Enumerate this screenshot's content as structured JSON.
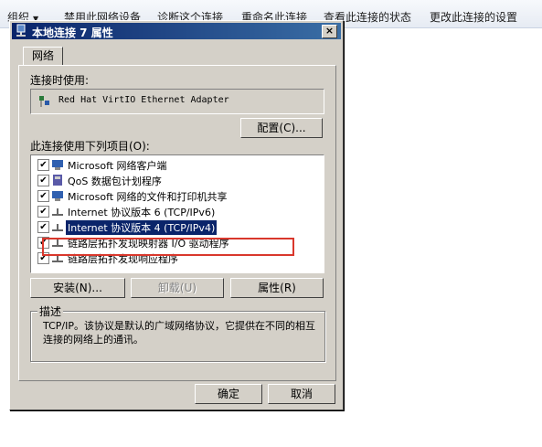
{
  "commandbar": {
    "items": [
      "组织",
      "禁用此网络设备",
      "诊断这个连接",
      "重命名此连接",
      "查看此连接的状态",
      "更改此连接的设置"
    ]
  },
  "dialog": {
    "title": "本地连接 7 属性",
    "close_label": "×",
    "tab_label": "网络",
    "connect_using_label": "连接时使用:",
    "adapter_name": "Red Hat VirtIO Ethernet Adapter",
    "configure_button": "配置(C)...",
    "items_label": "此连接使用下列项目(O):",
    "items": [
      {
        "label": "Microsoft 网络客户端",
        "checked": true,
        "icon": "client-icon"
      },
      {
        "label": "QoS 数据包计划程序",
        "checked": true,
        "icon": "qos-icon"
      },
      {
        "label": "Microsoft 网络的文件和打印机共享",
        "checked": true,
        "icon": "share-icon"
      },
      {
        "label": "Internet 协议版本 6 (TCP/IPv6)",
        "checked": true,
        "icon": "protocol-icon"
      },
      {
        "label": "Internet 协议版本 4 (TCP/IPv4)",
        "checked": true,
        "icon": "protocol-icon",
        "selected": true
      },
      {
        "label": "链路层拓扑发现映射器 I/O 驱动程序",
        "checked": true,
        "icon": "protocol-icon"
      },
      {
        "label": "链路层拓扑发现响应程序",
        "checked": true,
        "icon": "protocol-icon"
      }
    ],
    "install_button": "安装(N)...",
    "uninstall_button": "卸载(U)",
    "properties_button": "属性(R)",
    "description_title": "描述",
    "description_text": "TCP/IP。该协议是默认的广域网络协议，它提供在不同的相互连接的网络上的通讯。",
    "ok_button": "确定",
    "cancel_button": "取消"
  },
  "colors": {
    "title_bar": "#0a246a",
    "selection": "#0a246a",
    "highlight_box": "#d9372c",
    "dialog_face": "#d4d0c8"
  }
}
